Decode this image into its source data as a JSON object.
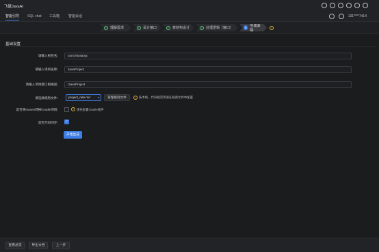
{
  "app": {
    "title": "飞鼠JavaAI"
  },
  "nav": {
    "tabs": [
      {
        "label": "智能引导"
      },
      {
        "label": "SQL chat"
      },
      {
        "label": "工具箱"
      },
      {
        "label": "智能会话"
      }
    ],
    "user": "131****7414"
  },
  "stepper": {
    "steps": [
      {
        "label": "理解需求"
      },
      {
        "label": "设计接口"
      },
      {
        "label": "表结构设计"
      },
      {
        "label": "处理逻辑（接口）"
      },
      {
        "label": "生成源码",
        "number": "5"
      }
    ]
  },
  "form": {
    "section_title": "基础设置",
    "package_label": "请输入根包名：",
    "package_value": "com.feiusanyc",
    "project_name_label": "请输入项目名称：",
    "project_name_value": "JavaProject",
    "project_path_label": "请输入项目接口根路径：",
    "project_path_value": "/JavaProject",
    "rule_label": "请选择规则文件：",
    "rule_value": "project_rule.md",
    "manage_rules_label": "管理规则文件",
    "rule_hint": "技术栈、代码规范等请在规则文件中配置",
    "gradle_label": "是否将maven转换Gradle项目：",
    "gradle_hint": "请先配置Gradle插件",
    "sync_label": "是否代码同步：",
    "generate_button": "开始生成"
  },
  "footer": {
    "buttons": [
      {
        "label": "查看总览"
      },
      {
        "label": "导出文档"
      },
      {
        "label": "上一步"
      }
    ]
  },
  "colors": {
    "accent": "#3f7ee8",
    "success": "#5cc17a",
    "warning": "#e3b23c"
  }
}
